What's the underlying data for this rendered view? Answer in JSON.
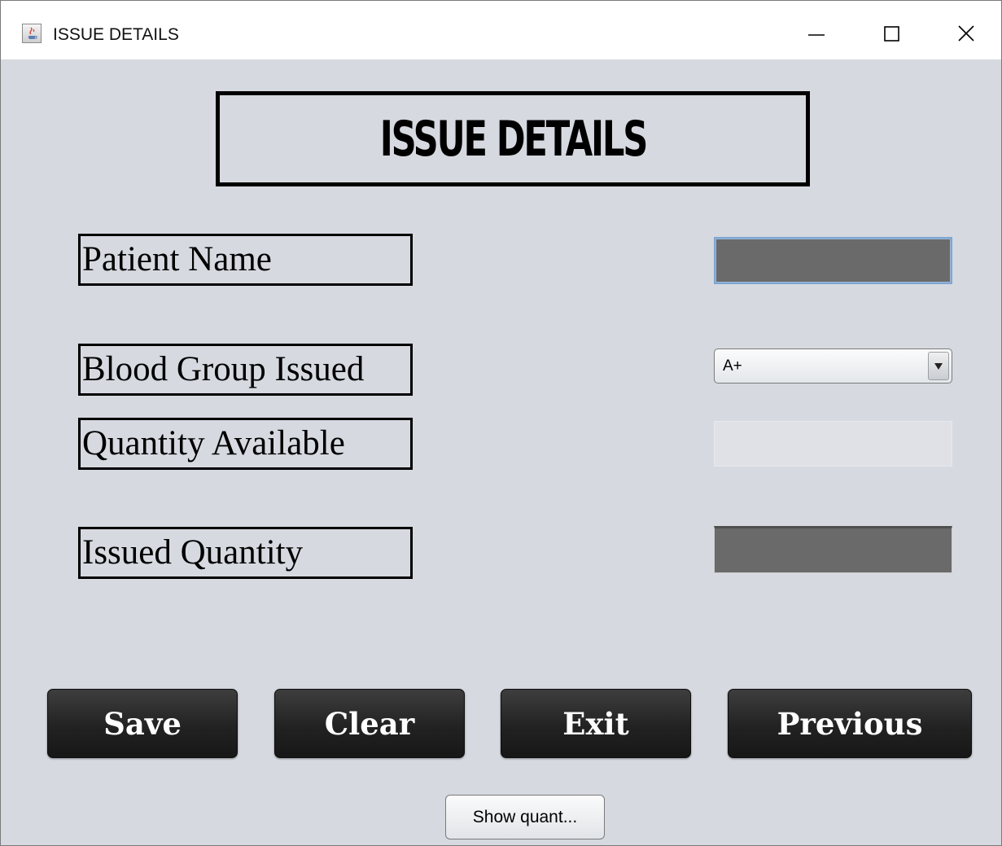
{
  "window": {
    "title": "ISSUE DETAILS",
    "icon": "java-cup-icon",
    "controls": [
      "minimize-icon",
      "maximize-icon",
      "close-icon"
    ]
  },
  "form": {
    "heading": "ISSUE DETAILS",
    "fields": {
      "patient_name": {
        "label": "Patient Name",
        "value": ""
      },
      "blood_group": {
        "label": "Blood Group Issued",
        "selected": "A+"
      },
      "quantity_available": {
        "label": "Quantity Available",
        "value": ""
      },
      "issued_quantity": {
        "label": "Issued Quantity",
        "value": ""
      }
    }
  },
  "buttons": {
    "save": "Save",
    "clear": "Clear",
    "exit": "Exit",
    "previous": "Previous",
    "show_quantity": "Show quant..."
  },
  "colors": {
    "background": "#d6d9e0",
    "input_dark": "#6a6a6a",
    "button_dark": "#222222",
    "focus_border": "#7ea6d2"
  }
}
